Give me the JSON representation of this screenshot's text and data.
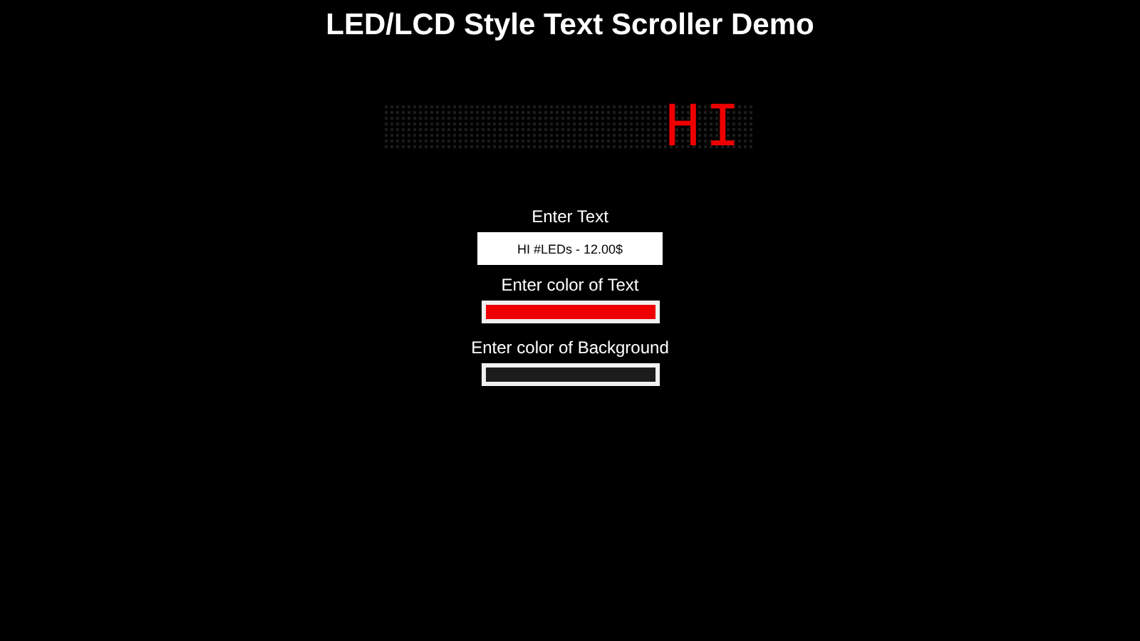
{
  "title": "LED/LCD Style Text Scroller Demo",
  "display": {
    "text": "HI"
  },
  "controls": [
    {
      "kind": "text",
      "label": "Enter Text",
      "value": "HI #LEDs - 12.00$"
    },
    {
      "kind": "color",
      "label": "Enter color of Text",
      "color": "#ee0000"
    },
    {
      "kind": "color",
      "label": "Enter color of Background",
      "color": "#1c1c1c"
    }
  ]
}
